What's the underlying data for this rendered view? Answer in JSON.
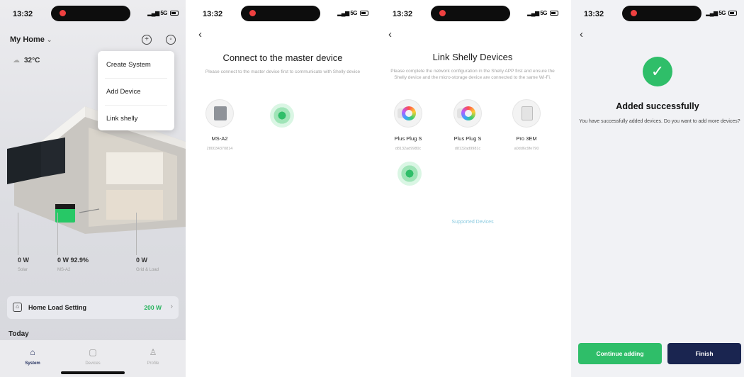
{
  "status_bar": {
    "time": "13:32",
    "signal": "5G"
  },
  "screen1": {
    "home_title": "My Home",
    "temperature": "32°C",
    "menu": [
      "Create System",
      "Add Device",
      "Link shelly"
    ],
    "stats": [
      {
        "value": "0 W",
        "label": "Solar"
      },
      {
        "value": "0 W  92.9%",
        "label": "MS-A2"
      },
      {
        "value": "0 W",
        "label": "Grid & Load"
      }
    ],
    "load_setting": {
      "label": "Home Load Setting",
      "value": "200 W"
    },
    "today_label": "Today",
    "tabs": [
      {
        "label": "System",
        "icon": "home-icon",
        "active": true
      },
      {
        "label": "Devices",
        "icon": "device-icon",
        "active": false
      },
      {
        "label": "Profile",
        "icon": "profile-icon",
        "active": false
      }
    ],
    "accent_color": "#25b35c"
  },
  "screen2": {
    "title": "Connect to the master device",
    "subtitle": "Please connect to the master device first to communicate with Shelly device",
    "device": {
      "name": "MS-A2",
      "id": "280034370814"
    }
  },
  "screen3": {
    "title": "Link Shelly Devices",
    "subtitle": "Please complete the network configuration in the Shelly APP first and ensure the Shelly device and the micro-storage device are connected to the same Wi-Fi.",
    "devices": [
      {
        "name": "Plus Plug S",
        "id": "d8132ad9980c"
      },
      {
        "name": "Plus Plug S",
        "id": "d8132ad9981c"
      },
      {
        "name": "Pro 3EM",
        "id": "a0dd6c9fe790"
      }
    ],
    "supported_link": "Supported Devices"
  },
  "screen4": {
    "title": "Added successfully",
    "subtitle": "You have successfully added devices. Do you want to add more devices?",
    "continue_button": "Continue adding",
    "finish_button": "Finish",
    "success_color": "#2fbe69",
    "finish_color": "#1a2550"
  }
}
